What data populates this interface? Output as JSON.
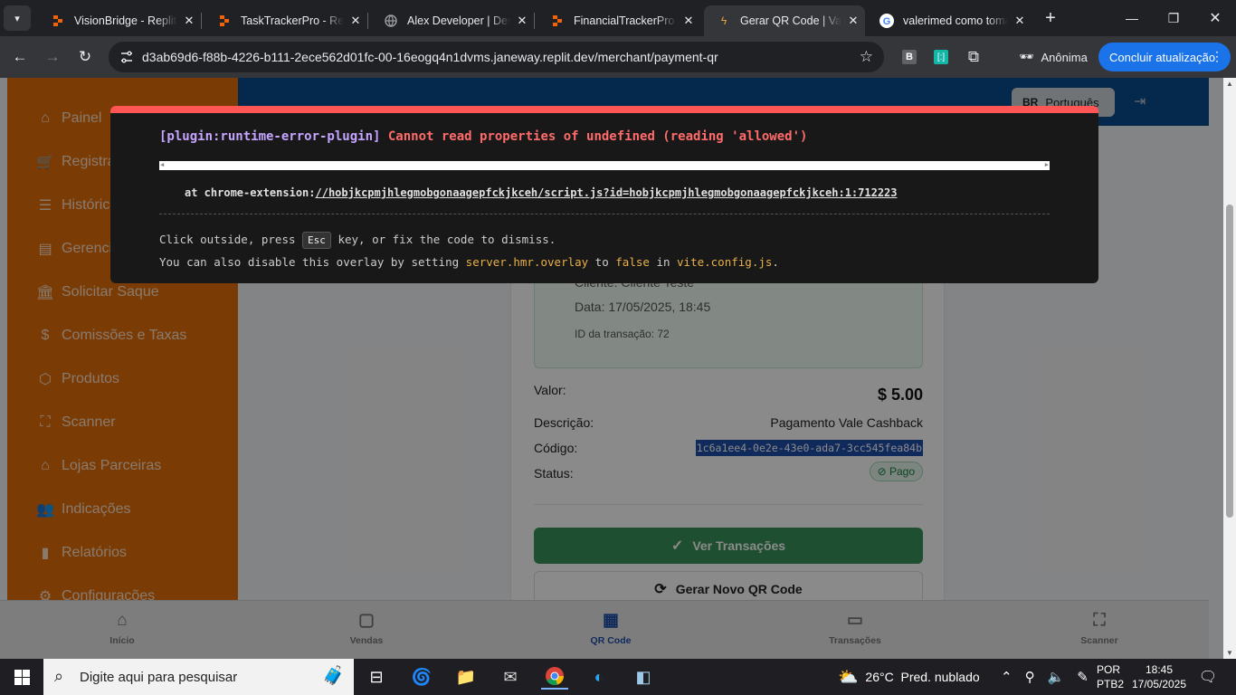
{
  "browser": {
    "tabs": [
      {
        "title": "VisionBridge - Replit",
        "icon": "replit-icon",
        "color": "#f26207"
      },
      {
        "title": "TaskTrackerPro - Replit",
        "icon": "replit-icon",
        "color": "#f26207"
      },
      {
        "title": "Alex Developer | Desc",
        "icon": "globe-icon",
        "color": "#9aa0a6"
      },
      {
        "title": "FinancialTrackerPro -",
        "icon": "replit-icon",
        "color": "#f26207"
      },
      {
        "title": "Gerar QR Code | Vale",
        "icon": "bolt-icon",
        "color": "#e8a33b"
      },
      {
        "title": "valerimed como tomar",
        "icon": "google-icon",
        "color": "#4285f4"
      }
    ],
    "url": "d3ab69d6-f88b-4226-b111-2ece562d01fc-00-16eogq4n1dvms.janeway.replit.dev/merchant/payment-qr",
    "profile_label": "Anônima",
    "update_label": "Concluir atualização"
  },
  "sidebar": {
    "items": [
      {
        "label": "Painel",
        "icon": "home-icon"
      },
      {
        "label": "Registrar",
        "icon": "cart-icon"
      },
      {
        "label": "Histórico",
        "icon": "list-icon"
      },
      {
        "label": "Gerenciar",
        "icon": "file-icon"
      },
      {
        "label": "Solicitar Saque",
        "icon": "bank-icon"
      },
      {
        "label": "Comissões e Taxas",
        "icon": "dollar-icon"
      },
      {
        "label": "Produtos",
        "icon": "box-icon"
      },
      {
        "label": "Scanner",
        "icon": "scan-icon"
      },
      {
        "label": "Lojas Parceiras",
        "icon": "store-icon"
      },
      {
        "label": "Indicações",
        "icon": "users-icon"
      },
      {
        "label": "Relatórios",
        "icon": "bar-chart-icon"
      },
      {
        "label": "Configurações",
        "icon": "gear-icon"
      }
    ]
  },
  "header": {
    "lang_code": "BR",
    "lang_label": "Português"
  },
  "payment": {
    "client": "Cliente: Cliente Teste",
    "date": "Data: 17/05/2025, 18:45",
    "transaction_id": "ID da transação: 72",
    "amount_label": "Valor:",
    "amount": "$ 5.00",
    "description_label": "Descrição:",
    "description": "Pagamento Vale Cashback",
    "code_label": "Código:",
    "code": "1c6a1ee4-0e2e-43e0-ada7-3cc545fea84b",
    "status_label": "Status:",
    "status": "Pago",
    "view_button": "Ver Transações",
    "new_qr_button": "Gerar Novo QR Code"
  },
  "bottom_nav": [
    {
      "label": "Início",
      "icon": "home-icon"
    },
    {
      "label": "Vendas",
      "icon": "bag-icon"
    },
    {
      "label": "QR Code",
      "icon": "qr-icon",
      "active": true
    },
    {
      "label": "Transações",
      "icon": "card-icon"
    },
    {
      "label": "Scanner",
      "icon": "scan-icon"
    }
  ],
  "error_overlay": {
    "plugin": "[plugin:runtime-error-plugin]",
    "message": "Cannot read properties of undefined (reading 'allowed')",
    "stack_prefix": "at chrome-extension:",
    "stack_link": "//hobjkcpmjhlegmobgonaagepfckjkceh/script.js?id=hobjkcpmjhlegmobgonaagepfckjkceh:1:712223",
    "tip_1a": "Click outside, press",
    "tip_key": "Esc",
    "tip_1b": "key, or fix the code to dismiss.",
    "tip_2a": "You can also disable this overlay by setting",
    "tip_2b": "server.hmr.overlay",
    "tip_2c": "to",
    "tip_2d": "false",
    "tip_2e": "in",
    "tip_2f": "vite.config.js",
    "tip_2g": "."
  },
  "taskbar": {
    "search_placeholder": "Digite aqui para pesquisar",
    "weather": "26°C  Pred. nublado",
    "lang_1": "POR",
    "lang_2": "PTB2",
    "time": "18:45",
    "date": "17/05/2025"
  }
}
